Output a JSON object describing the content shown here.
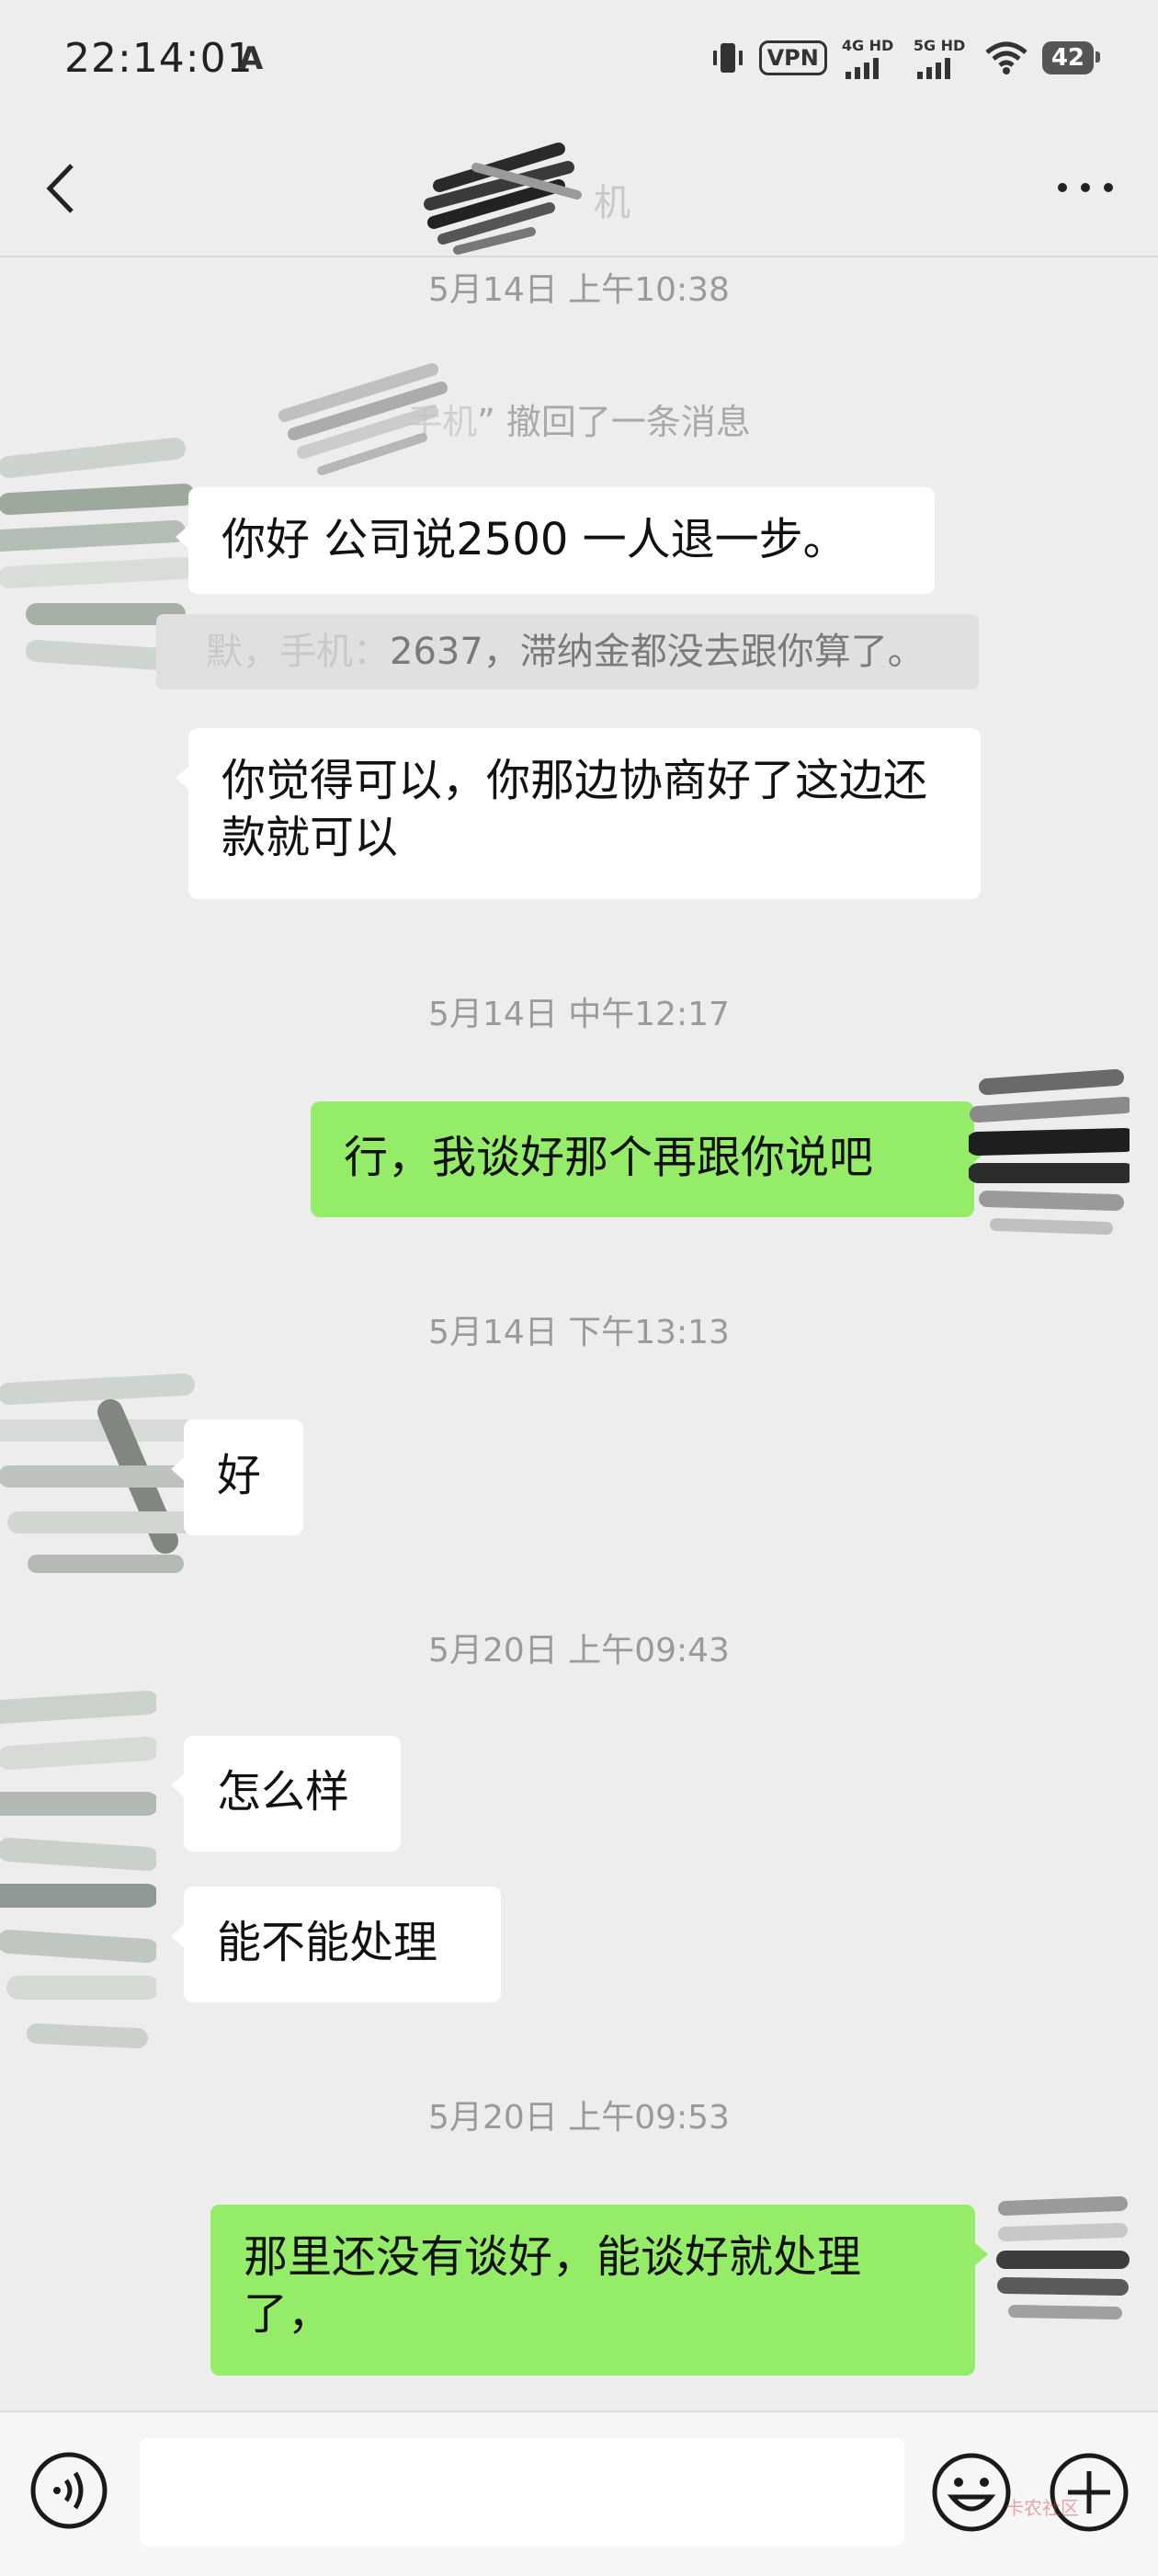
{
  "status_bar": {
    "time": "22:14:01",
    "indicator": "A",
    "vpn": "VPN",
    "net1": "4G HD",
    "net2": "5G HD",
    "battery": "42"
  },
  "header": {
    "title_tail": "机",
    "back_icon": "chevron-left-icon",
    "more_icon": "more-dots-icon"
  },
  "messages": {
    "ts1": "5月14日 上午10:38",
    "recall_prefix": "手机",
    "recall_text": "” 撤回了一条消息",
    "msg1": "你好 公司说2500  一人退一步。",
    "quote_blur": "默，手机：",
    "quote_text": "2637，滞纳金都没去跟你算了。",
    "msg2": "你觉得可以，你那边协商好了这边还款就可以",
    "ts2": "5月14日 中午12:17",
    "msg3": "行，我谈好那个再跟你说吧",
    "ts3": "5月14日 下午13:13",
    "msg4": "好",
    "ts4": "5月20日 上午09:43",
    "msg5": "怎么样",
    "msg6": "能不能处理",
    "ts5": "5月20日 上午09:53",
    "msg7": "那里还没有谈好，能谈好就处理了，"
  },
  "input_bar": {
    "voice_icon": "voice-icon",
    "emoji_icon": "emoji-icon",
    "plus_icon": "plus-icon",
    "watermark": "卡农社区"
  },
  "colors": {
    "background": "#ededed",
    "incoming_bubble": "#ffffff",
    "outgoing_bubble": "#95ec69"
  }
}
